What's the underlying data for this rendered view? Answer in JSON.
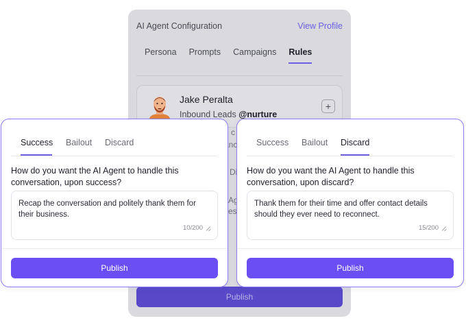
{
  "background_panel": {
    "title": "AI Agent Configuration",
    "view_profile": "View Profile",
    "tabs": [
      "Persona",
      "Prompts",
      "Campaigns",
      "Rules"
    ],
    "active_tab": "Rules",
    "agent": {
      "name": "Jake Peralta",
      "role": "Inbound Leads",
      "handle": "@nurture",
      "add_icon": "plus-icon"
    },
    "peek_texts": [
      "u c",
      "anc",
      "Di",
      "Ag",
      "ess"
    ],
    "publish_label": "Publish"
  },
  "left_card": {
    "tabs": [
      "Success",
      "Bailout",
      "Discard"
    ],
    "active_tab": "Success",
    "question": "How do you want the AI Agent to handle this conversation, upon success?",
    "text": "Recap the conversation and politely thank them for their business.",
    "counter": "10/200",
    "publish_label": "Publish"
  },
  "right_card": {
    "tabs": [
      "Success",
      "Bailout",
      "Discard"
    ],
    "active_tab": "Discard",
    "question": "How do you want the AI Agent to handle this conversation, upon discard?",
    "text": "Thank them for their time and offer contact details should they ever need to reconnect.",
    "counter": "15/200",
    "publish_label": "Publish"
  },
  "colors": {
    "accent": "#6b4ff5",
    "tab_underline": "#6b5fe6",
    "card_border": "#8b7cf6"
  }
}
